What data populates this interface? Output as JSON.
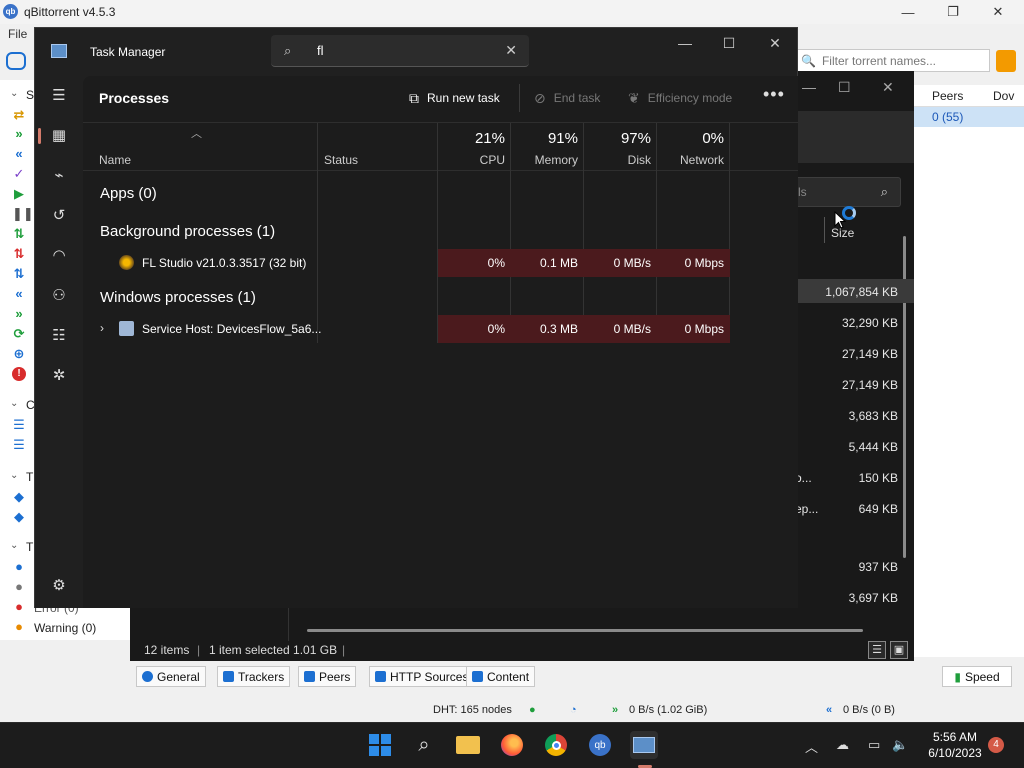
{
  "qbittorrent": {
    "title": "qBittorrent v4.5.3",
    "menu_file": "File",
    "filter_placeholder": "Filter torrent names...",
    "column_peers": "Peers",
    "column_down": "Dov",
    "peers_value": "0 (55)",
    "sidebar": {
      "section_status_letter": "S",
      "section_categories_letter": "C",
      "section_tags_letter": "T",
      "section_trackers_letter": "T",
      "error_item": "Error (0)",
      "warning_item": "Warning (0)"
    },
    "bottom_tabs": [
      "General",
      "Trackers",
      "Peers",
      "HTTP Sources",
      "Content"
    ],
    "speed_button": "Speed",
    "statusbar": {
      "dht": "DHT: 165 nodes",
      "download": "0 B/s (1.02 GiB)",
      "upload": "0 B/s (0 B)"
    }
  },
  "explorer": {
    "search_placeholder": "ls",
    "size_header": "Size",
    "rows": [
      {
        "name": "",
        "size": "1,067,854 KB",
        "selected": true
      },
      {
        "name": "",
        "size": "32,290 KB"
      },
      {
        "name": "",
        "size": "27,149 KB"
      },
      {
        "name": "",
        "size": "27,149 KB"
      },
      {
        "name": "",
        "size": "3,683 KB"
      },
      {
        "name": "",
        "size": "5,444 KB"
      },
      {
        "name": "o...",
        "size": "150 KB"
      },
      {
        "name": "ep...",
        "size": "649 KB"
      },
      {
        "name": "",
        "size": ""
      },
      {
        "name": "",
        "size": "937 KB"
      },
      {
        "name": "",
        "size": "3,697 KB"
      }
    ],
    "status_items": "12 items",
    "status_selected": "1 item selected  1.01 GB"
  },
  "task_manager": {
    "title": "Task Manager",
    "search_value": "fl",
    "page_title": "Processes",
    "commands": {
      "run_new_task": "Run new task",
      "end_task": "End task",
      "efficiency_mode": "Efficiency mode"
    },
    "columns": {
      "name": "Name",
      "status": "Status",
      "cpu_pct": "21%",
      "cpu": "CPU",
      "memory_pct": "91%",
      "memory": "Memory",
      "disk_pct": "97%",
      "disk": "Disk",
      "network_pct": "0%",
      "network": "Network"
    },
    "groups": {
      "apps": "Apps (0)",
      "background": "Background processes (1)",
      "windows": "Windows processes (1)"
    },
    "processes": [
      {
        "name": "FL Studio v21.0.3.3517 (32 bit)",
        "cpu": "0%",
        "memory": "0.1 MB",
        "disk": "0 MB/s",
        "network": "0 Mbps"
      },
      {
        "name": "Service Host: DevicesFlow_5a6...",
        "cpu": "0%",
        "memory": "0.3 MB",
        "disk": "0 MB/s",
        "network": "0 Mbps"
      }
    ]
  },
  "taskbar": {
    "time": "5:56 AM",
    "date": "6/10/2023",
    "notification_count": "4"
  },
  "colors": {
    "qbt_blue": "#1c6fd1",
    "tm_bg": "#202020",
    "metric_heat": "#4b1a1d",
    "win_accent": "#2d8ce8"
  }
}
